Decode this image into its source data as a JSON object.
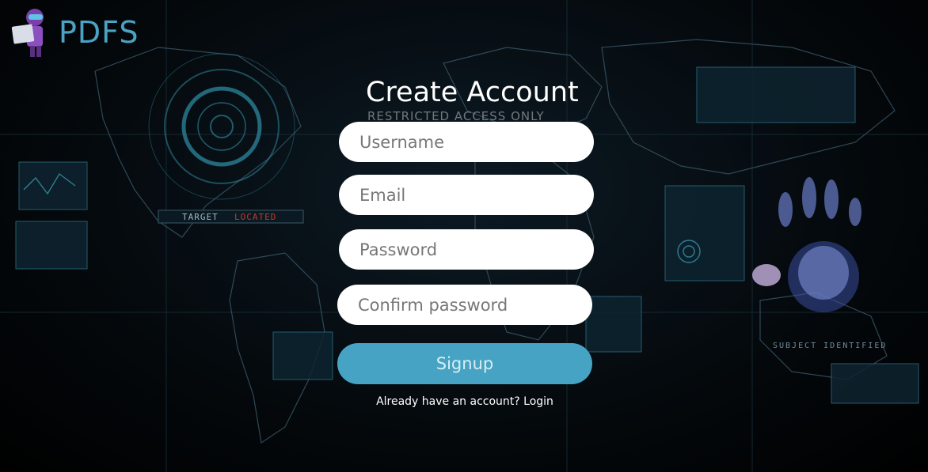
{
  "brand": {
    "name": "PDFS",
    "accent_color": "#4aa3c4"
  },
  "background": {
    "hud_left_label": "TARGET",
    "hud_left_status": "LOCATED",
    "hud_right_label": "SUBJECT IDENTIFIED"
  },
  "form": {
    "title": "Create Account",
    "subtitle": "RESTRICTED ACCESS ONLY",
    "username_placeholder": "Username",
    "email_placeholder": "Email",
    "password_placeholder": "Password",
    "confirm_placeholder": "Confirm password",
    "signup_label": "Signup",
    "signup_color": "#47a3c3",
    "login_prompt": "Already have an account?",
    "login_label": "Login"
  }
}
